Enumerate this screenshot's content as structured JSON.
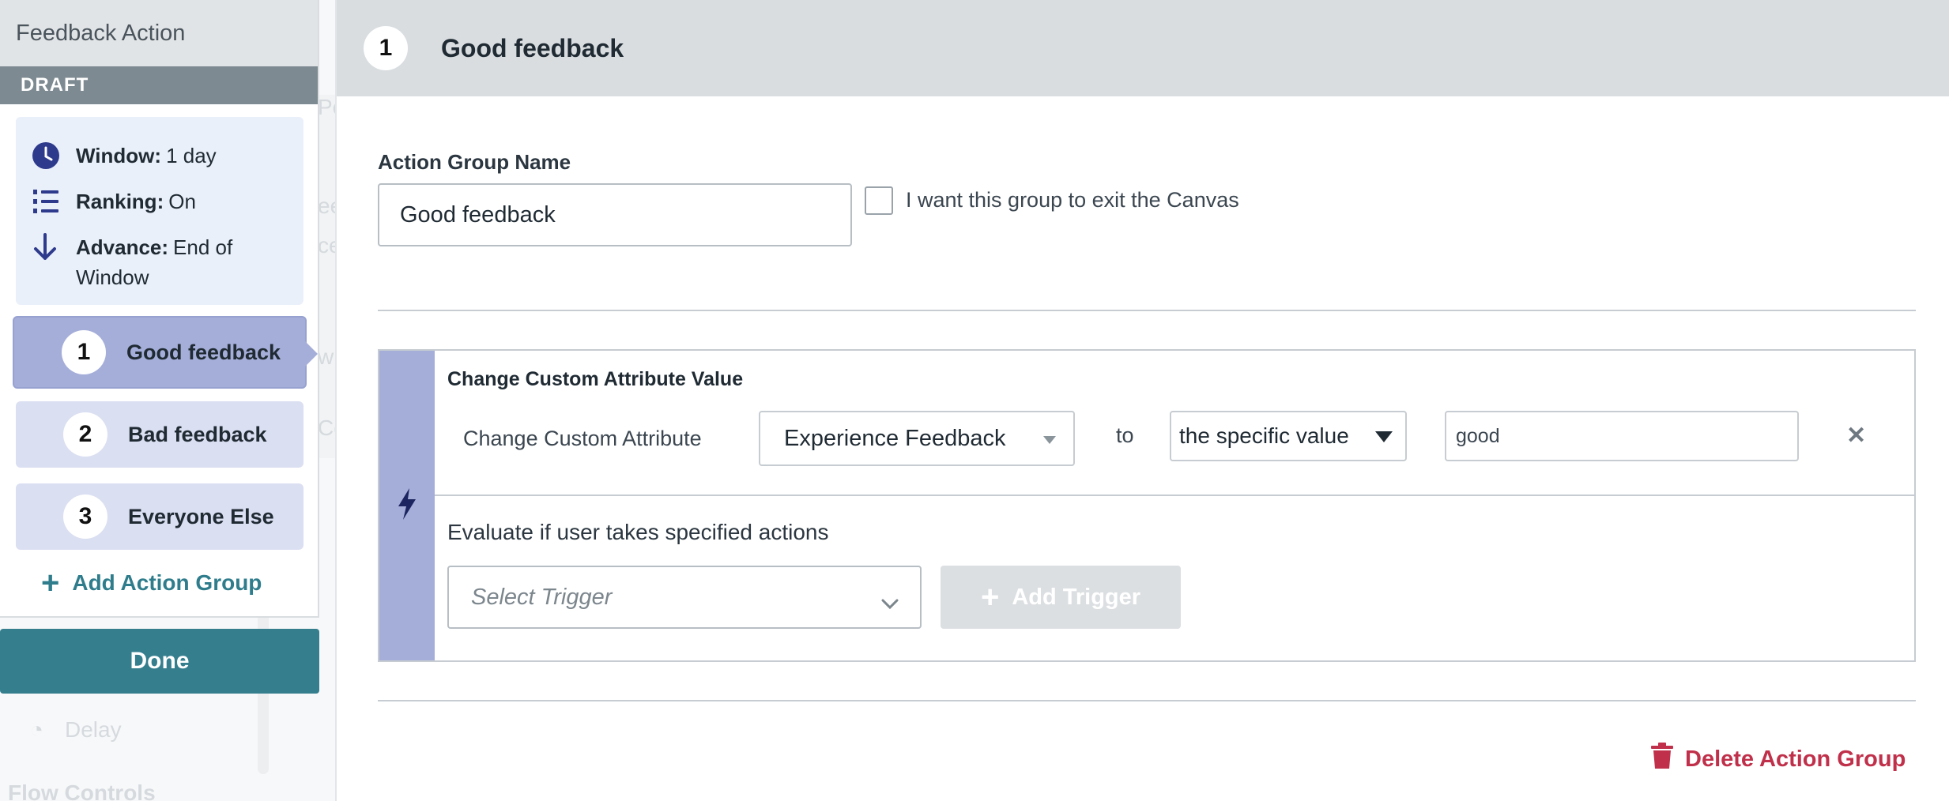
{
  "background": {
    "ghost_texts": [
      "Pe",
      "ee",
      "ce",
      "wi",
      "Co",
      "Delay",
      "Flow Controls"
    ]
  },
  "left_panel": {
    "title": "Feedback Action",
    "status": "DRAFT",
    "info": {
      "window_label": "Window:",
      "window_value": "1 day",
      "ranking_label": "Ranking:",
      "ranking_value": "On",
      "advance_label": "Advance:",
      "advance_value": "End of Window"
    },
    "groups": [
      {
        "number": "1",
        "name": "Good feedback",
        "active": true
      },
      {
        "number": "2",
        "name": "Bad feedback",
        "active": false
      },
      {
        "number": "3",
        "name": "Everyone Else",
        "active": false
      }
    ],
    "add_group_label": "Add Action Group",
    "done_label": "Done"
  },
  "main": {
    "header": {
      "number": "1",
      "title": "Good feedback"
    },
    "name_label": "Action Group Name",
    "name_value": "Good feedback",
    "exit_checkbox_label": "I want this group to exit the Canvas",
    "exit_checked": false,
    "action": {
      "title": "Change Custom Attribute Value",
      "attribute_label": "Change Custom Attribute",
      "attribute_value": "Experience Feedback",
      "to_label": "to",
      "value_mode": "the specific value",
      "value": "good"
    },
    "evaluate_label": "Evaluate if user takes specified actions",
    "trigger_placeholder": "Select Trigger",
    "add_trigger_label": "Add Trigger",
    "delete_label": "Delete Action Group"
  },
  "colors": {
    "accent_teal": "#347e8e",
    "group_active": "#a5aed9",
    "group_inactive": "#dadff1",
    "info_bg": "#eaf0fa",
    "danger": "#c0304a",
    "icon_navy": "#2e3a8c"
  }
}
